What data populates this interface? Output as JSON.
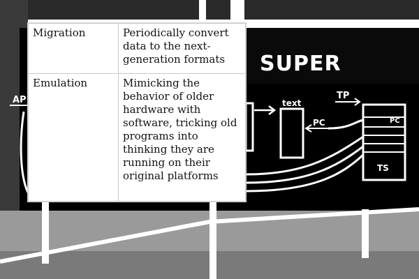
{
  "background": {
    "board_title": "SUPER",
    "labels": {
      "ap": "AP",
      "text": "text",
      "tp": "TP",
      "pc_left": "PC",
      "pc_right": "PC",
      "ts": "TS"
    }
  },
  "table": {
    "rows": [
      {
        "term": "Migration",
        "definition": "Periodically convert data to the next-generation formats"
      },
      {
        "term": "Emulation",
        "definition": "Mimicking the behavior of older hardware with software, tricking old programs into thinking they are running on their original platforms"
      }
    ]
  },
  "colors": {
    "board": "#000000",
    "chalk": "#ffffff",
    "table_border": "#c9c9c9",
    "text": "#111111"
  }
}
